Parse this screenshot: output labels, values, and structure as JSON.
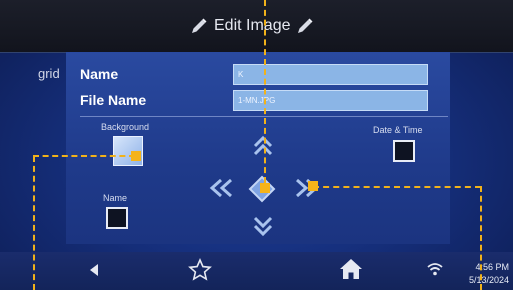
{
  "header": {
    "title": "Edit Image"
  },
  "side": {
    "grid_label": "grid"
  },
  "form": {
    "name_label": "Name",
    "name_value": "K",
    "filename_label": "File Name",
    "filename_value": "1-MN.JPG"
  },
  "options": {
    "background_label": "Background",
    "datetime_label": "Date & Time",
    "name_label": "Name"
  },
  "status": {
    "time": "4:56 PM",
    "date": "5/13/2024"
  },
  "icons": {
    "title_left": "pencil-icon",
    "title_right": "pencil-icon",
    "nav_back": "back-triangle-icon",
    "nav_favorites": "star-outline-icon",
    "nav_home": "home-icon",
    "wifi": "wifi-icon",
    "arrows": [
      "double-chevron-up-icon",
      "double-chevron-left-icon",
      "move-diamond-icon",
      "double-chevron-right-icon",
      "double-chevron-down-icon"
    ]
  },
  "colors": {
    "accent_dashes": "#f1b21a",
    "screen_blue": "#1f3a8a",
    "input_fill": "#8bb5e6"
  }
}
